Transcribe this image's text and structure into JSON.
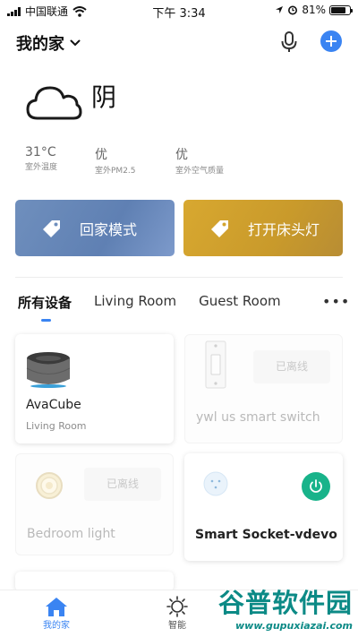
{
  "status_bar": {
    "carrier": "中国联通",
    "time": "下午 3:34",
    "battery": "81%",
    "battery_level": 0.81
  },
  "header": {
    "home_name": "我的家"
  },
  "weather": {
    "condition": "阴",
    "stats": [
      {
        "value": "31°C",
        "label": "室外温度"
      },
      {
        "value": "优",
        "label": "室外PM2.5"
      },
      {
        "value": "优",
        "label": "室外空气质量"
      }
    ]
  },
  "scenes": [
    {
      "label": "回家模式",
      "color": "#6f8fbd"
    },
    {
      "label": "打开床头灯",
      "color": "#d3a530"
    }
  ],
  "tabs": {
    "items": [
      "所有设备",
      "Living Room",
      "Guest Room"
    ],
    "more": "•••"
  },
  "devices": [
    {
      "name": "AvaCube",
      "room": "Living Room",
      "status": "online"
    },
    {
      "name": "ywl us smart switch",
      "room": "",
      "status": "已离线"
    },
    {
      "name": "Bedroom light",
      "room": "",
      "status": "已离线"
    },
    {
      "name": "Smart Socket-vdevo",
      "room": "",
      "status": "online"
    }
  ],
  "bottom_nav": {
    "items": [
      "我的家",
      "智能"
    ]
  },
  "watermark": {
    "big": "谷普软件园",
    "small": "www.gupuxiazai.com"
  },
  "colors": {
    "accent": "#3a84f2",
    "power_on": "#18b38a"
  }
}
